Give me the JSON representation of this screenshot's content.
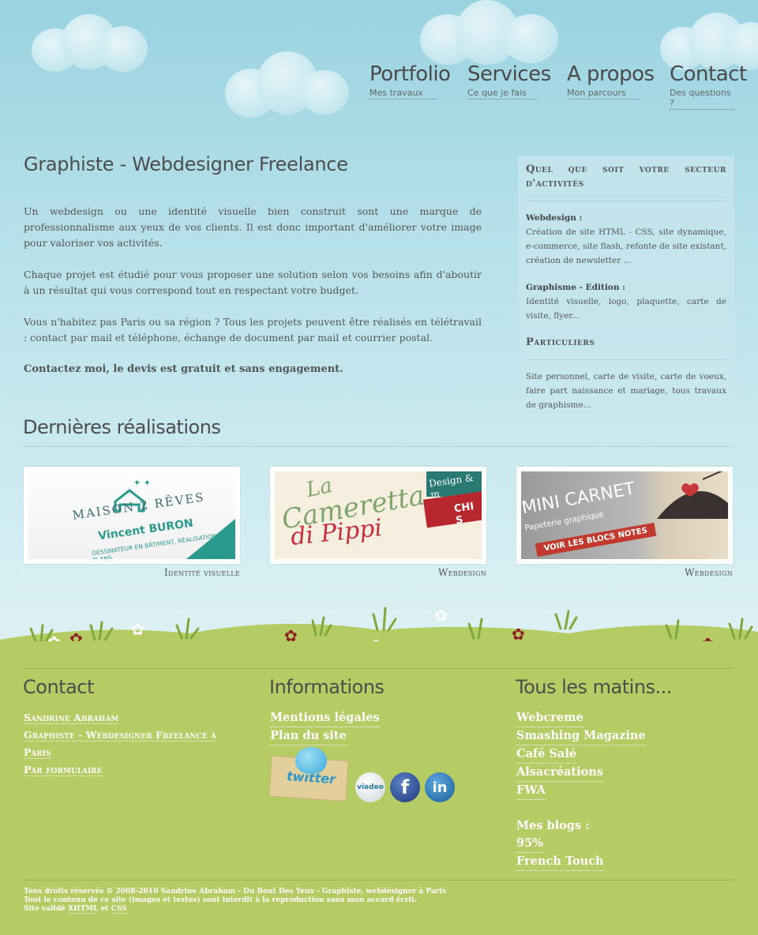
{
  "nav": [
    {
      "title": "Portfolio",
      "sub": "Mes travaux"
    },
    {
      "title": "Services",
      "sub": "Ce que je fais"
    },
    {
      "title": "A propos",
      "sub": "Mon parcours"
    },
    {
      "title": "Contact",
      "sub": "Des questions ?"
    }
  ],
  "main": {
    "title": "Graphiste - Webdesigner Freelance",
    "paragraphs": [
      "Un webdesign ou une identité visuelle bien construit sont une marque de professionnalisme aux yeux de vos clients. Il est donc important d'améliorer votre image pour valoriser vos activités.",
      "Chaque projet est étudié pour vous proposer une solution selon vos besoins afin d'aboutir à un résultat qui vous correspond tout en respectant votre budget.",
      "Vous n'habitez pas Paris ou sa région ? Tous les projets peuvent être réalisés en télétravail : contact par mail et téléphone, échange de document par mail et courrier postal."
    ],
    "cta": "Contactez moi, le devis est gratuit et sans engagement."
  },
  "sidebar": {
    "heading1": "Quel que soit votre secteur d'activités",
    "webdesign_label": "Webdesign :",
    "webdesign_text": "Création de site HTML - CSS, site dynamique, e-commerce, site flash, refonte de site existant, création de newsletter ...",
    "graphisme_label": "Graphisme - Edition :",
    "graphisme_text": "Identité visuelle, logo, plaquette, carte de visite, flyer...",
    "heading2": "Particuliers",
    "particuliers_text": "Site personnel, carte de visite, carte de voeux, faire part naissance et mariage, tous travaux de graphisme..."
  },
  "realisations": {
    "title": "Dernières réalisations",
    "items": [
      {
        "caption": "Identité visuelle",
        "line1": "MAISON 2 RÊVES",
        "line2": "Vincent BURON",
        "line3": "DESSINATEUR EN BÂTIMENT, RÉALISATION DE PLANS"
      },
      {
        "caption": "Webdesign",
        "line1": "La",
        "line2": "Cameretta",
        "line3": "di Pippi",
        "line4": "Design & m",
        "line5": "CHI S"
      },
      {
        "caption": "Webdesign",
        "line1": "MINI CARNET",
        "line2": "Papeterie graphique",
        "line3": "VOIR LES BLOCS NOTES"
      }
    ]
  },
  "footer": {
    "contact": {
      "title": "Contact",
      "name": "Sandrine Abraham",
      "role": "Graphiste - Webdesigner Freelance à Paris",
      "form": "Par formulaire"
    },
    "informations": {
      "title": "Informations",
      "links": [
        "Mentions légales",
        "Plan du site"
      ]
    },
    "social": {
      "twitter": "twitter",
      "viadeo": "viadeo",
      "facebook": "f",
      "linkedin": "in"
    },
    "matins": {
      "title": "Tous les matins...",
      "links": [
        "Webcreme",
        "Smashing Magazine",
        "Café Salé",
        "Alsacréations",
        "FWA"
      ],
      "blogs_label": "Mes blogs :",
      "blogs": [
        "95%",
        "French Touch"
      ]
    },
    "legal": {
      "line1": "Tous droits réservés © 2008-2010 Sandrine Abraham - Du Bout Des Yeux - Graphiste, webdesigner à Paris",
      "line2": "Tout le contenu de ce site (images et textes) sont interdit à la reproduction sans mon accord écrit.",
      "line3_prefix": "Site validé",
      "xhtml": "XHTML",
      "and": "et",
      "css": "CSS"
    }
  }
}
